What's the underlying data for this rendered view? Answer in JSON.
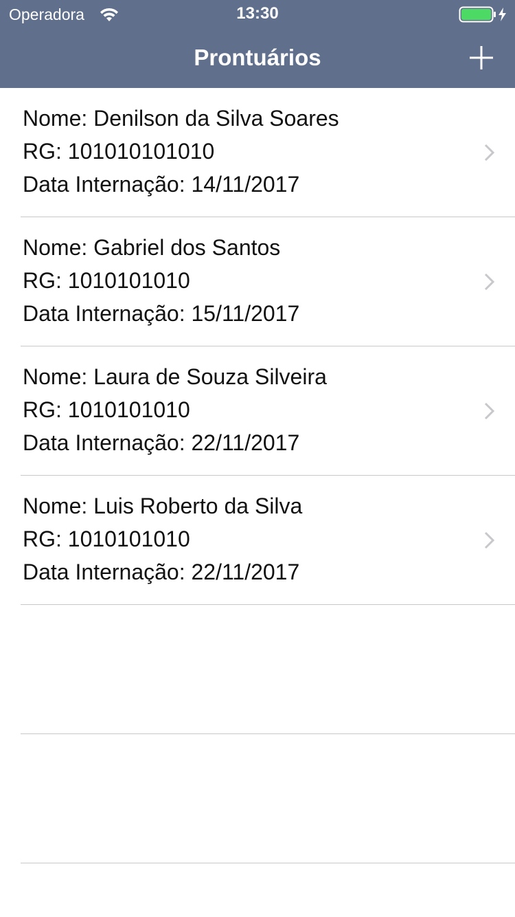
{
  "status_bar": {
    "carrier": "Operadora",
    "time": "13:30",
    "wifi_icon": "wifi-icon",
    "battery_icon": "battery-charging-icon",
    "battery_color": "#4cd964"
  },
  "nav_bar": {
    "title": "Prontuários",
    "add_icon": "plus-icon",
    "background_color": "#5f6f8c"
  },
  "records": [
    {
      "name": "Nome: Denilson da Silva Soares",
      "rg": "RG: 101010101010",
      "date": "Data Internação: 14/11/2017"
    },
    {
      "name": "Nome: Gabriel dos Santos",
      "rg": "RG: 1010101010",
      "date": "Data Internação: 15/11/2017"
    },
    {
      "name": "Nome: Laura de Souza Silveira",
      "rg": "RG: 1010101010",
      "date": "Data Internação: 22/11/2017"
    },
    {
      "name": "Nome: Luis Roberto da Silva",
      "rg": "RG: 1010101010",
      "date": "Data Internação: 22/11/2017"
    }
  ]
}
